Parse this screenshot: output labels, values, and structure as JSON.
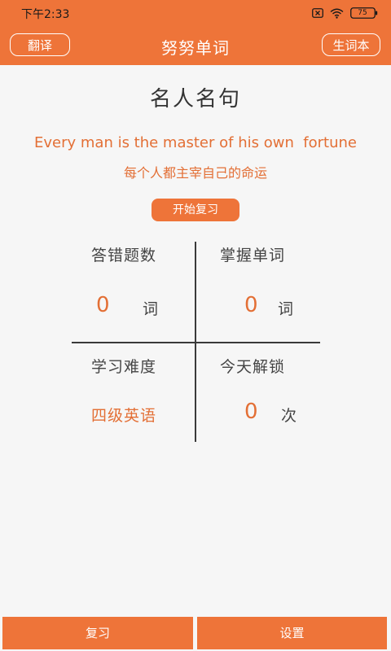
{
  "status_bar": {
    "time": "下午2:33",
    "battery": "75",
    "icons": [
      "close-box-icon",
      "wifi-icon",
      "battery-icon"
    ]
  },
  "toolbar": {
    "title": "努努单词",
    "left_button": "翻译",
    "right_button": "生词本"
  },
  "quote": {
    "heading": "名人名句",
    "english": "Every man is the master of his own  fortune",
    "chinese": "每个人都主宰自己的命运"
  },
  "start_button": "开始复习",
  "stats": {
    "wrong_answers": {
      "label": "答错题数",
      "value": "0",
      "unit": "词"
    },
    "mastered_words": {
      "label": "掌握单词",
      "value": "0",
      "unit": "词"
    },
    "difficulty": {
      "label": "学习难度",
      "value": "四级英语"
    },
    "unlocks_today": {
      "label": "今天解锁",
      "value": "0",
      "unit": "次"
    }
  },
  "bottom_bar": {
    "review": "复习",
    "settings": "设置"
  },
  "colors": {
    "accent": "#ee7439",
    "accent_text": "#e36f35",
    "background": "#f6f6f6",
    "text": "#444444"
  }
}
